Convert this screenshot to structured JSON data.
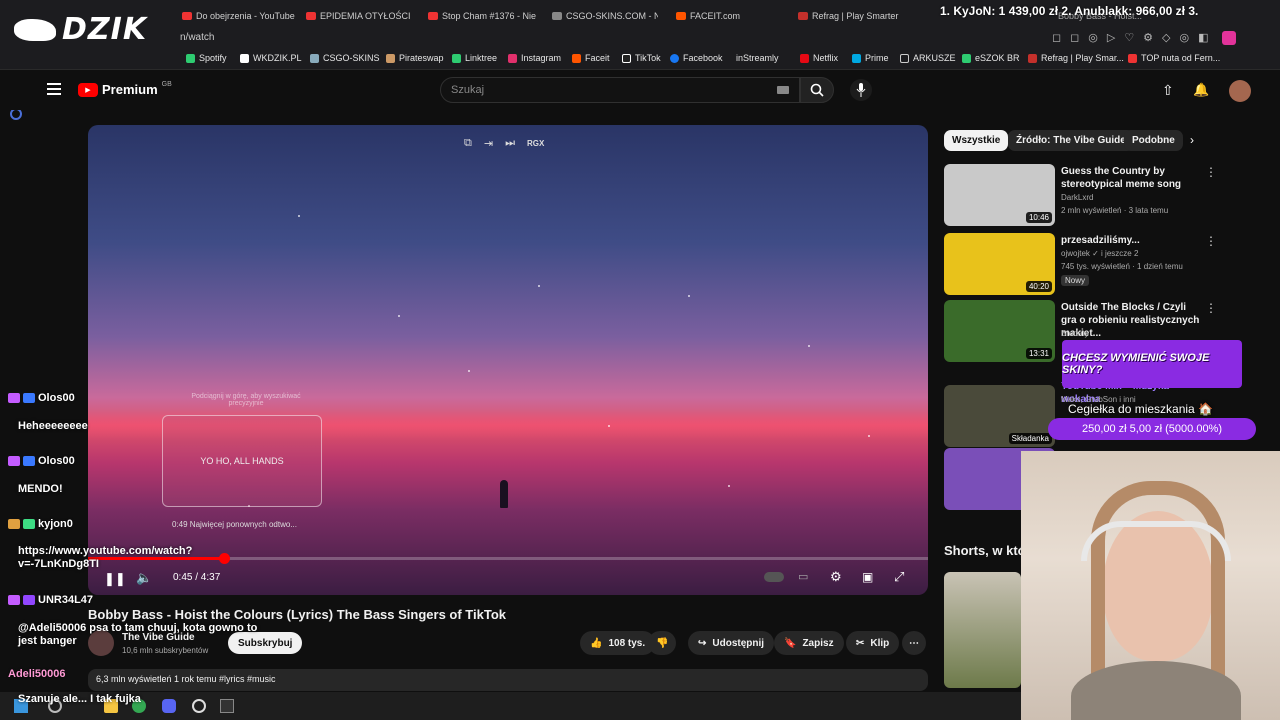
{
  "tabs": [
    "Do obejrzenia - YouTube",
    "EPIDEMIA OTYŁOŚCI K...",
    "Stop Cham #1376 - Nie...",
    "CSGO-SKINS.COM - Na...",
    "FACEIT.com",
    "Refrag | Play Smarter",
    "Bobby Bass - Hoist..."
  ],
  "url": "n/watch",
  "donation_ticker": "1. KyJoN: 1 439,00 zł  2. Anublakk: 966,00 zł  3.",
  "bookmarks": [
    "Spotify",
    "WKDZIK.PL",
    "CSGO-SKINS",
    "Pirateswap",
    "Linktree",
    "Instagram",
    "Faceit",
    "TikTok",
    "Facebook",
    "inStreamly",
    "Netflix",
    "Prime",
    "ARKUSZE",
    "eSZOK BR",
    "Refrag | Play Smar...",
    "TOP nuta od Fern..."
  ],
  "overlay_logo": "DZIK",
  "yt": {
    "brand": "Premium",
    "region": "GB",
    "search_placeholder": "Szukaj"
  },
  "player": {
    "top_controls": [
      "RGX"
    ],
    "preview_text": "YO HO, ALL HANDS",
    "seek_hint": "Podciągnij w górę, aby wyszukiwać precyzyjnie",
    "most_replayed": "0:49  Najwięcej ponownych odtwo...",
    "time": "0:45 / 4:37",
    "progress_fraction": 0.162
  },
  "video": {
    "title": "Bobby Bass - Hoist the Colours (Lyrics) The Bass Singers of TikTok",
    "channel": "The Vibe Guide",
    "subs": "10,6 mln subskrybentów",
    "subscribe": "Subskrybuj",
    "likes": "108 tys.",
    "share": "Udostępnij",
    "save": "Zapisz",
    "clip": "Klip",
    "description": "6,3 mln wyświetleń  1 rok temu  #lyrics #music"
  },
  "chips": [
    "Wszystkie",
    "Źródło: The Vibe Guide",
    "Podobne"
  ],
  "recommended": [
    {
      "title": "Guess the Country by stereotypical meme song",
      "channel": "DarkLxrd",
      "meta": "2 mln wyświetleń · 3 lata temu",
      "duration": "10:46",
      "thumb": "#c9c9c9"
    },
    {
      "title": "przesadziliśmy...",
      "channel": "ojwojtek ✓ i jeszcze 2",
      "meta": "745 tys. wyświetleń · 1 dzień temu",
      "badge": "Nowy",
      "duration": "40:20",
      "thumb": "#e8c21b"
    },
    {
      "title": "Outside The Blocks / Czyli gra o robieniu realistycznych makiet...",
      "channel": "Brodaty",
      "meta": "",
      "duration": "13:31",
      "thumb": "#3a6b2a"
    },
    {
      "title": "YouTube Mix – Muzyka wokalna",
      "channel": "Mako, GrubSon i inni",
      "meta": "",
      "duration": "Składanka",
      "thumb": "#4a4a3a"
    },
    {
      "title": "",
      "channel": "",
      "meta": "",
      "duration": "",
      "thumb": "#7a4fb8"
    }
  ],
  "shorts_label": "Shorts, w któ",
  "promo": {
    "banner": "CHCESZ WYMIENIĆ SWOJE SKINY?",
    "goal_title": "Cegiełka do mieszkania 🏠",
    "goal_value": "250,00 zł  5,00 zł (5000.00%)"
  },
  "chat": [
    {
      "user": "Olos00",
      "msg": "Heheeeeeeee"
    },
    {
      "user": "Olos00",
      "msg": "MENDO!"
    },
    {
      "user": "kyjon0",
      "msg": "https://www.youtube.com/watch?v=-7LnKnDg8TI"
    },
    {
      "user": "UNR34L47",
      "msg": "@Adeli50006 psa to tam chuuj, kota gowno to jest banger"
    },
    {
      "user": "Adeli50006",
      "msg": "Szanuje ale... I tak fujka"
    }
  ],
  "colors": {
    "yt_red": "#ff0000",
    "chat_purple": "#9146ff",
    "promo_purple": "#8a2be2"
  }
}
